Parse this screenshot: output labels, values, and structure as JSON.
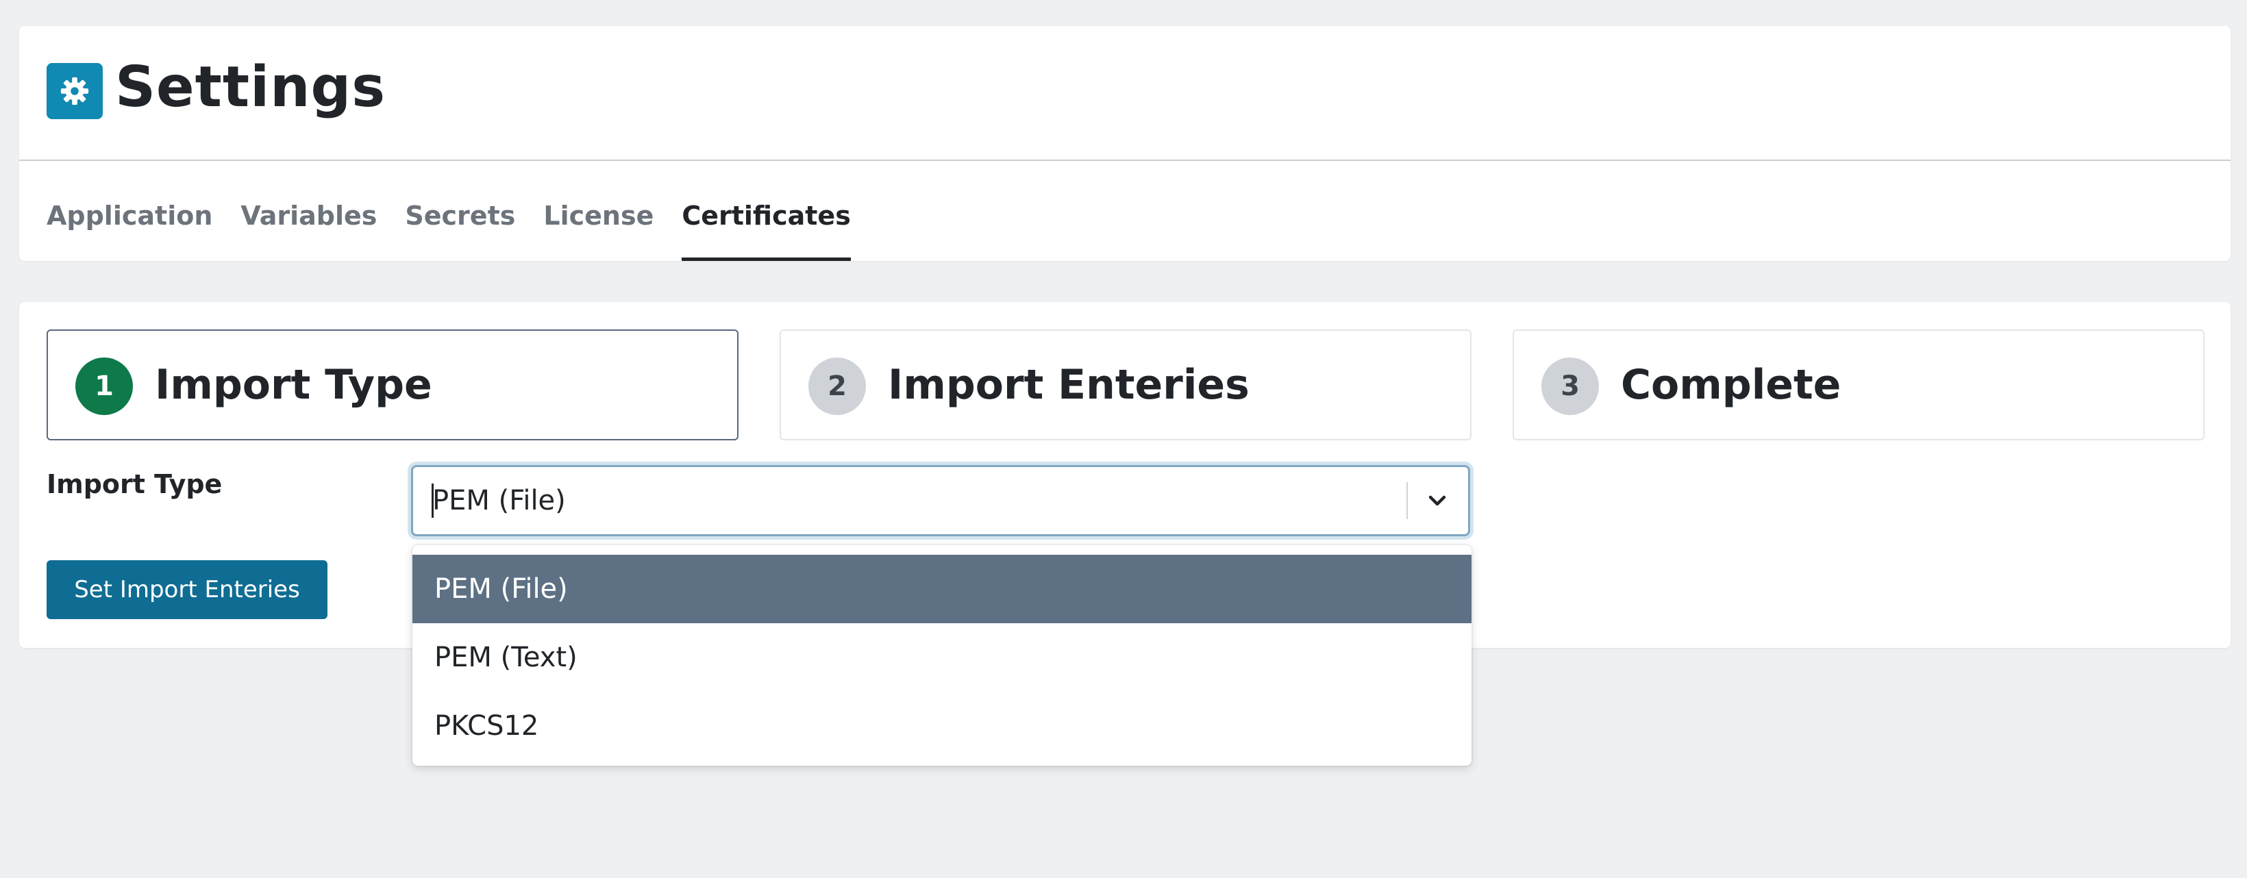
{
  "header": {
    "title": "Settings",
    "icon": "gear-icon",
    "icon_bg": "#1089b3"
  },
  "tabs": [
    {
      "label": "Application",
      "active": false
    },
    {
      "label": "Variables",
      "active": false
    },
    {
      "label": "Secrets",
      "active": false
    },
    {
      "label": "License",
      "active": false
    },
    {
      "label": "Certificates",
      "active": true
    }
  ],
  "steps": [
    {
      "number": "1",
      "label": "Import Type",
      "active": true
    },
    {
      "number": "2",
      "label": "Import Enteries",
      "active": false
    },
    {
      "number": "3",
      "label": "Complete",
      "active": false
    }
  ],
  "form": {
    "import_type_label": "Import Type",
    "select_value": "PEM (File)",
    "submit_label": "Set Import Enteries"
  },
  "dropdown": {
    "options": [
      "PEM (File)",
      "PEM (Text)",
      "PKCS12"
    ],
    "selected_index": 0
  },
  "colors": {
    "active_step": "#0e7a4a",
    "primary": "#0f6d93",
    "option_highlight": "#5d7084"
  }
}
